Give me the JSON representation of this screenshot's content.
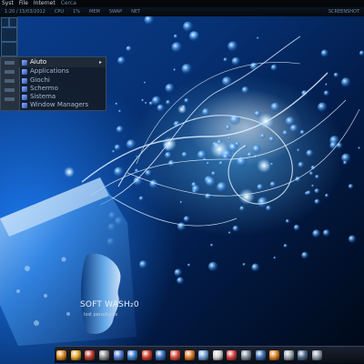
{
  "top_panel": {
    "menus": [
      "Syst",
      "File",
      "Internet"
    ],
    "extra_label": "Cerca"
  },
  "status_bar": {
    "segments": [
      "1:20 / 15/03/2012",
      "CPU",
      "1%",
      "MEM",
      "SWAP",
      "NET",
      "SCREENSHOT"
    ]
  },
  "launcher_menu": {
    "items": [
      {
        "label": "Aiuto",
        "selected": true,
        "has_submenu": true
      },
      {
        "label": "Applications",
        "selected": false,
        "has_submenu": false
      },
      {
        "label": "Giochi",
        "selected": false,
        "has_submenu": false
      },
      {
        "label": "Schermo",
        "selected": false,
        "has_submenu": false
      },
      {
        "label": "Sistema",
        "selected": false,
        "has_submenu": false
      },
      {
        "label": "Window Managers",
        "selected": false,
        "has_submenu": false
      }
    ],
    "submenu_arrow": "▸"
  },
  "wallpaper": {
    "title": "SOFT WASH₂0",
    "subtitle": "lost paradigms"
  },
  "dock": {
    "icons": [
      {
        "name": "folder-icon",
        "color": "#d98a1e"
      },
      {
        "name": "terminal-icon",
        "color": "#e6a52b"
      },
      {
        "name": "gear-icon",
        "color": "#c23b2b"
      },
      {
        "name": "gimp-icon",
        "color": "#8d8d8d"
      },
      {
        "name": "thunderbird-icon",
        "color": "#4c7bd1"
      },
      {
        "name": "chat-icon",
        "color": "#3a7fd0"
      },
      {
        "name": "pdf-icon",
        "color": "#d23a2a"
      },
      {
        "name": "search-icon",
        "color": "#3a6fc4"
      },
      {
        "name": "chrome-icon",
        "color": "#d94b3b"
      },
      {
        "name": "firefox-icon",
        "color": "#e07a22"
      },
      {
        "name": "image-viewer-icon",
        "color": "#6fa0d6"
      },
      {
        "name": "mail-icon",
        "color": "#cfcfcf"
      },
      {
        "name": "calendar-icon",
        "color": "#d94040"
      },
      {
        "name": "settings-icon",
        "color": "#7f8d9c"
      },
      {
        "name": "network-icon",
        "color": "#3f6fb5"
      },
      {
        "name": "media-player-icon",
        "color": "#e08020"
      },
      {
        "name": "disk-icon",
        "color": "#9aa6b2"
      },
      {
        "name": "monitor-icon",
        "color": "#4a6a90"
      },
      {
        "name": "trash-icon",
        "color": "#8c9aa8"
      }
    ]
  }
}
